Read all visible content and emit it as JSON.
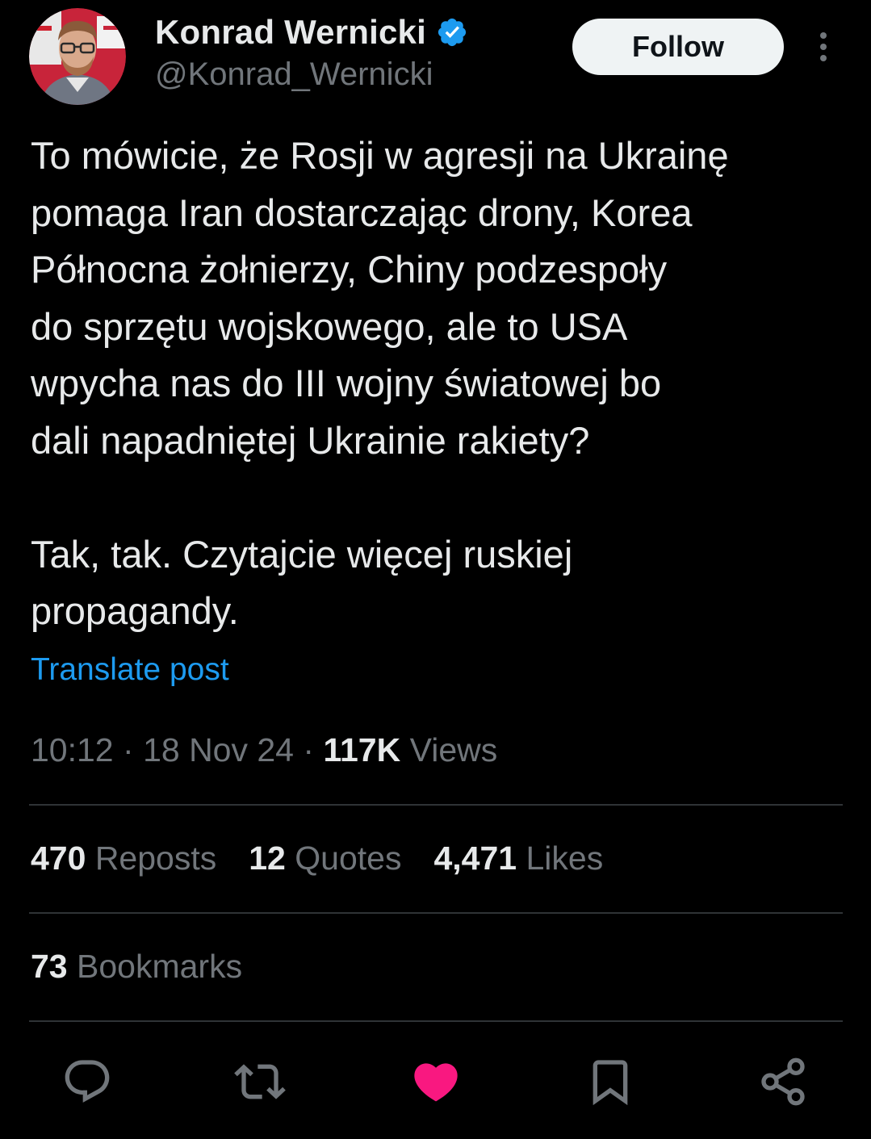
{
  "author": {
    "display_name": "Konrad Wernicki",
    "handle": "@Konrad_Wernicki",
    "verified": true
  },
  "follow_label": "Follow",
  "post": {
    "text": "To mówicie, że Rosji w agresji na Ukrainę\npomaga Iran dostarczając drony, Korea\nPółnocna żołnierzy, Chiny podzespoły\ndo sprzętu wojskowego, ale to USA\nwpycha nas do III wojny światowej bo\ndali napadniętej Ukrainie rakiety?\n\nTak, tak. Czytajcie więcej ruskiej\npropagandy.",
    "translate_label": "Translate post"
  },
  "meta": {
    "time": "10:12",
    "sep1": "·",
    "date": "18 Nov 24",
    "sep2": "·",
    "views_count": "117K",
    "views_label": "Views"
  },
  "stats": {
    "reposts_count": "470",
    "reposts_label": "Reposts",
    "quotes_count": "12",
    "quotes_label": "Quotes",
    "likes_count": "4,471",
    "likes_label": "Likes",
    "bookmarks_count": "73",
    "bookmarks_label": "Bookmarks"
  },
  "actions": {
    "icons": [
      "reply-icon",
      "repost-icon",
      "like-icon",
      "bookmark-icon",
      "share-icon"
    ],
    "liked": true
  },
  "colors": {
    "background": "#000000",
    "text_primary": "#e7e9ea",
    "text_secondary": "#71767b",
    "link": "#1d9bf0",
    "verified": "#1d9bf0",
    "like_active": "#f91880",
    "divider": "#2f3336"
  }
}
